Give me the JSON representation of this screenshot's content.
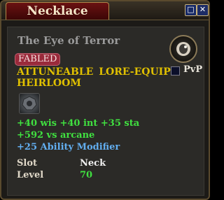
{
  "window": {
    "title": "Necklace",
    "buttons": {
      "restore_icon": "restore-icon",
      "close_icon": "close-icon"
    }
  },
  "item": {
    "name": "The Eye of Terror",
    "tier_badge": "FABLED",
    "flags_line1": "ATTUNEABLE   LORE-EQUIP",
    "flags_line2": "HEIRLOOM",
    "icon": "necklace-icon",
    "stats_line": "+40 wis   +40 int   +35 sta",
    "arcane_line": "+592 vs arcane",
    "ability_modifier": "+25 Ability Modifier",
    "slot_label": "Slot",
    "slot_value": "Neck",
    "level_label": "Level",
    "level_value": "70"
  },
  "pvp": {
    "label": "PvP",
    "checked": false
  },
  "colors": {
    "fabled_badge": "#9a2a3b",
    "flags": "#e0c000",
    "stat_green": "#40e040",
    "modifier_blue": "#62aef0",
    "item_name": "#9b9b9b",
    "title_bar_red": "#6a1212"
  }
}
